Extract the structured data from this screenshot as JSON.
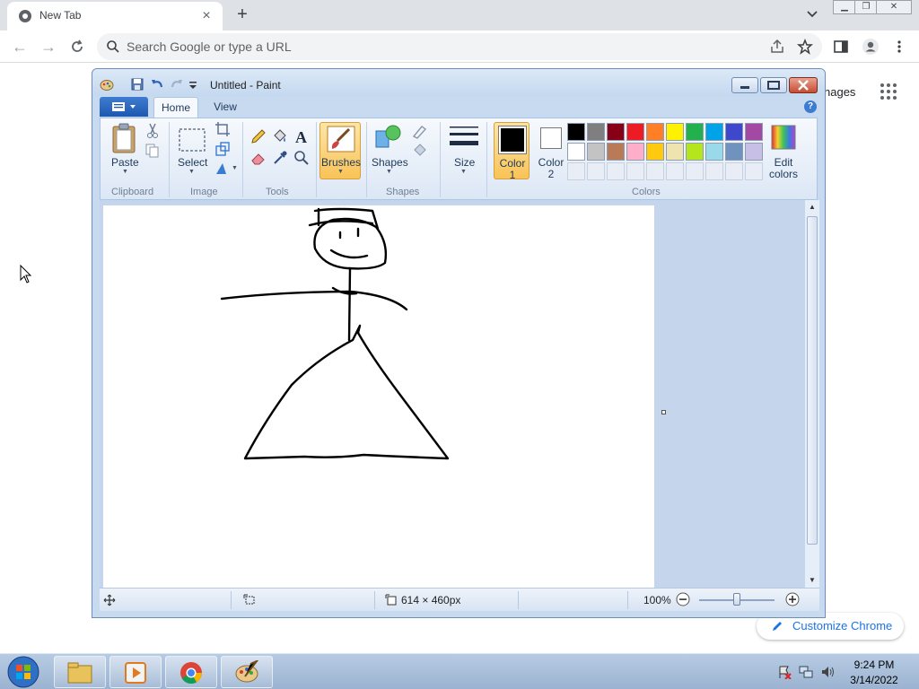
{
  "browser": {
    "tab_title": "New Tab",
    "tab_close": "×",
    "new_tab": "+",
    "omnibox_placeholder": "Search Google or type a URL",
    "images_link": "nages",
    "customize_label": "Customize Chrome",
    "colors": {
      "tabbar": "#dee1e6",
      "accent": "#1a73e8"
    }
  },
  "paint": {
    "title": "Untitled - Paint",
    "tabs": {
      "home": "Home",
      "view": "View"
    },
    "help": "?",
    "groups": {
      "clipboard": "Clipboard",
      "image": "Image",
      "tools": "Tools",
      "shapes": "Shapes",
      "colors": "Colors"
    },
    "buttons": {
      "paste": "Paste",
      "select": "Select",
      "brushes": "Brushes",
      "shapes": "Shapes",
      "size": "Size",
      "color1_a": "Color",
      "color1_b": "1",
      "color2_a": "Color",
      "color2_b": "2",
      "edit_colors_a": "Edit",
      "edit_colors_b": "colors"
    },
    "palette": [
      "#000000",
      "#7f7f7f",
      "#880015",
      "#ed1c24",
      "#ff7f27",
      "#fff200",
      "#22b14c",
      "#00a2e8",
      "#3f48cc",
      "#a349a4",
      "#ffffff",
      "#c3c3c3",
      "#b97a57",
      "#ffaec9",
      "#ffc90e",
      "#efe4b0",
      "#b5e61d",
      "#99d9ea",
      "#7092be",
      "#c8bfe7"
    ],
    "color1": "#000000",
    "color2": "#ffffff",
    "status": {
      "canvas_size": "614 × 460px",
      "zoom": "100%",
      "zoom_level_fraction": 0.5
    }
  },
  "taskbar": {
    "time": "9:24 PM",
    "date": "3/14/2022"
  }
}
